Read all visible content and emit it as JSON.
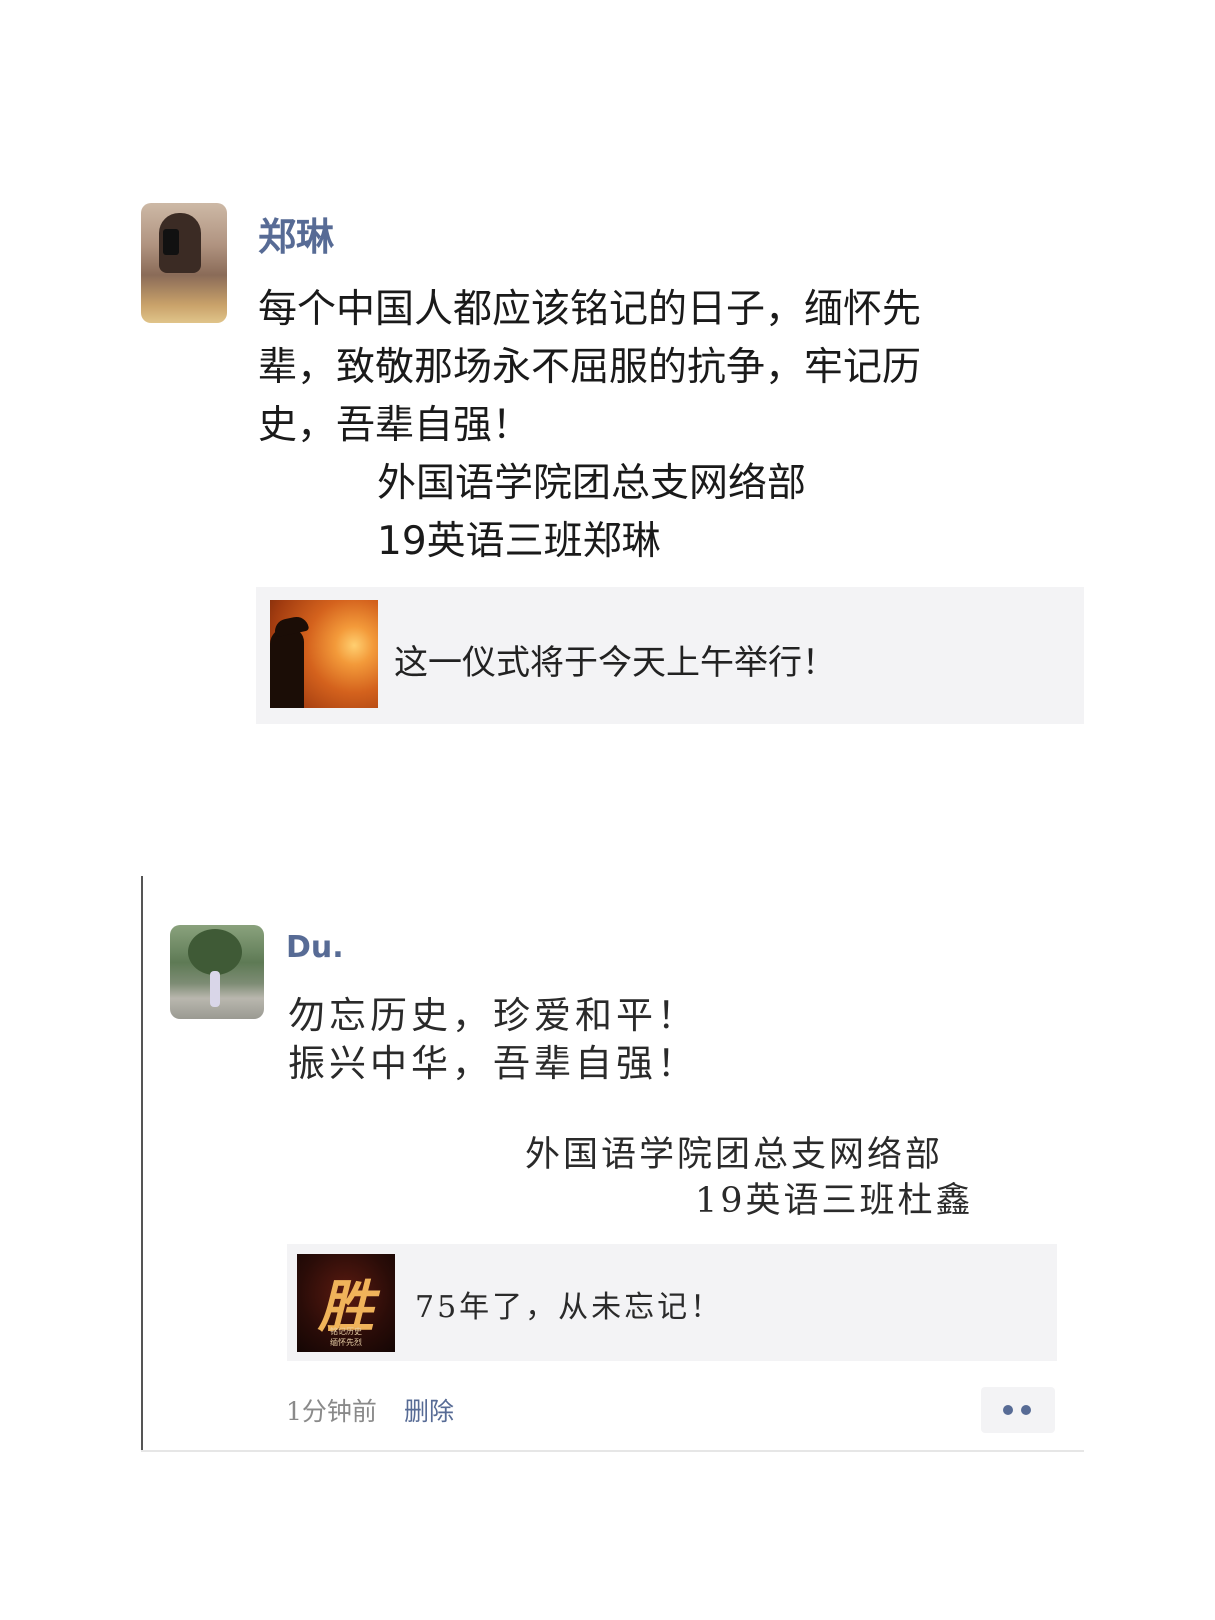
{
  "post1": {
    "author": "郑琳",
    "lines": [
      "每个中国人都应该铭记的日子，缅怀先",
      "辈，致敬那场永不屈服的抗争，牢记历",
      "史，吾辈自强！",
      "外国语学院团总支网络部",
      "19英语三班郑琳"
    ],
    "link": {
      "title": "这一仪式将于今天上午举行！"
    }
  },
  "post2": {
    "author": "Du.",
    "lines": [
      "勿忘历史，珍爱和平！",
      "振兴中华，吾辈自强！",
      "外国语学院团总支网络部",
      "19英语三班杜鑫"
    ],
    "link": {
      "title": "75年了，从未忘记！",
      "thumb_glyph": "胜",
      "thumb_caption_1": "铭记历史",
      "thumb_caption_2": "缅怀先烈"
    },
    "meta": {
      "time": "1分钟前",
      "delete_label": "删除"
    }
  },
  "colors": {
    "name": "#576b95",
    "card_bg": "#f3f3f5"
  }
}
